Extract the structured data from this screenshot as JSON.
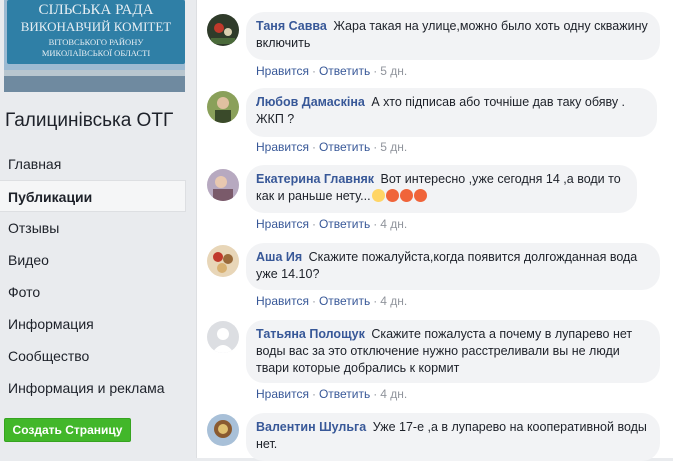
{
  "sidebar": {
    "cover_lines": [
      "СІЛЬСЬКА РАДА",
      "ВИКОНАВЧИЙ КОМІТЕТ",
      "ВІТОВСЬКОГО РАЙОНУ",
      "МИКОЛАЇВСЬКОЇ ОБЛАСТІ"
    ],
    "page_name": "Галицинівська ОТГ",
    "nav": [
      {
        "label": "Главная"
      },
      {
        "label": "Публикации",
        "active": true
      },
      {
        "label": "Отзывы"
      },
      {
        "label": "Видео"
      },
      {
        "label": "Фото"
      },
      {
        "label": "Информация"
      },
      {
        "label": "Сообщество"
      },
      {
        "label": "Информация и реклама"
      }
    ],
    "create_button": "Создать Страницу"
  },
  "actions": {
    "like": "Нравится",
    "reply": "Ответить",
    "separator": "·"
  },
  "comments": [
    {
      "author": "Таня Савва",
      "text": "Жара такая на улице,можно было хоть одну скважину включить",
      "time": "5 дн.",
      "avatar_color": "#2f3b2a"
    },
    {
      "author": "Любов Дамаскіна",
      "text": "А хто підписав або точніше дав таку обяву . ЖКП ?",
      "time": "5 дн.",
      "avatar_color": "#5a6b3a"
    },
    {
      "author": "Екатерина Главняк",
      "text": "Вот интересно ,уже сегодня 14 ,а води то как и раньше нету...",
      "time": "4 дн.",
      "avatar_color": "#7a5a6a",
      "emoji": [
        "scream-emoji",
        "angry-emoji",
        "angry-emoji",
        "angry-emoji"
      ]
    },
    {
      "author": "Аша Ия",
      "text": "Скажите пожалуйста,когда появится долгожданная вода уже 14.10?",
      "time": "4 дн.",
      "avatar_color": "#c9a070"
    },
    {
      "author": "Татьяна Полощук",
      "text": "Скажите пожалуста а почему в лупарево нет воды вас за это отключение нужно расстреливали вы не люди твари которые добрались к кормит",
      "time": "4 дн.",
      "avatar_color": "#c8ccd2"
    },
    {
      "author": "Валентин Шульга",
      "text": "Уже 17-е ,а в лупарево на кооперативной воды нет.",
      "avatar_color": "#6b4a2a"
    }
  ]
}
